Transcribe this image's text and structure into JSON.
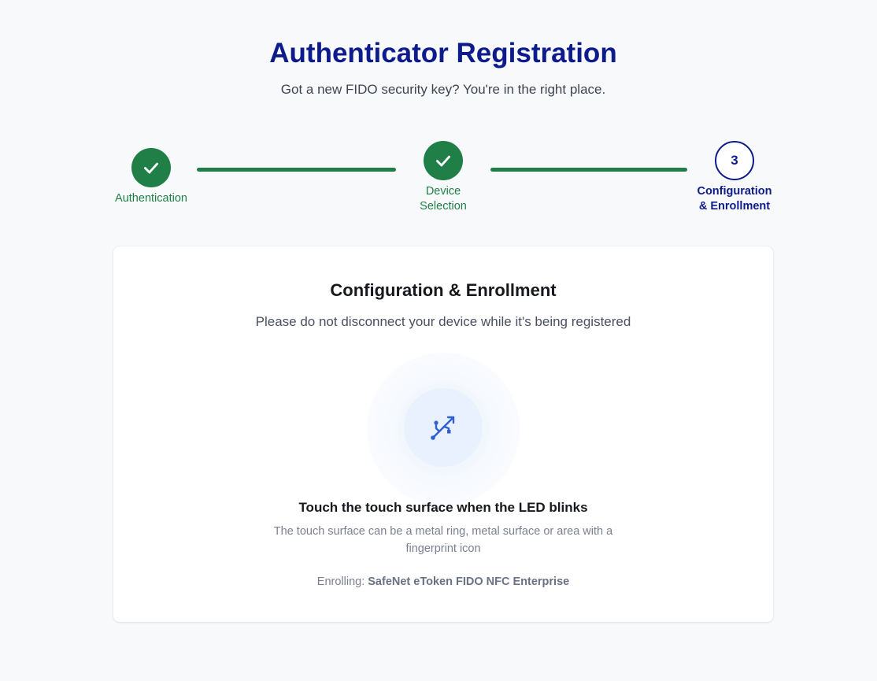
{
  "header": {
    "title": "Authenticator Registration",
    "subtitle": "Got a new FIDO security key? You're in the right place."
  },
  "stepper": {
    "steps": [
      {
        "label_line1": "Authentication",
        "label_line2": "",
        "status": "completed",
        "icon": "check-icon"
      },
      {
        "label_line1": "Device",
        "label_line2": "Selection",
        "status": "completed",
        "icon": "check-icon"
      },
      {
        "label_line1": "Configuration",
        "label_line2": "& Enrollment",
        "status": "active",
        "number": "3"
      }
    ]
  },
  "card": {
    "title": "Configuration & Enrollment",
    "subtitle": "Please do not disconnect your device while it's being registered",
    "icon": "usb-icon",
    "instruction_title": "Touch the touch surface when the LED blinks",
    "instruction_description": "The touch surface can be a metal ring, metal surface or area with a fingerprint icon",
    "enrolling_label": "Enrolling:",
    "enrolling_device": "SafeNet eToken FIDO NFC Enterprise"
  },
  "colors": {
    "brand_navy": "#0d1b8c",
    "success_green": "#1f7f46",
    "icon_blue": "#2f5fd0",
    "background": "#f8f9fb"
  }
}
